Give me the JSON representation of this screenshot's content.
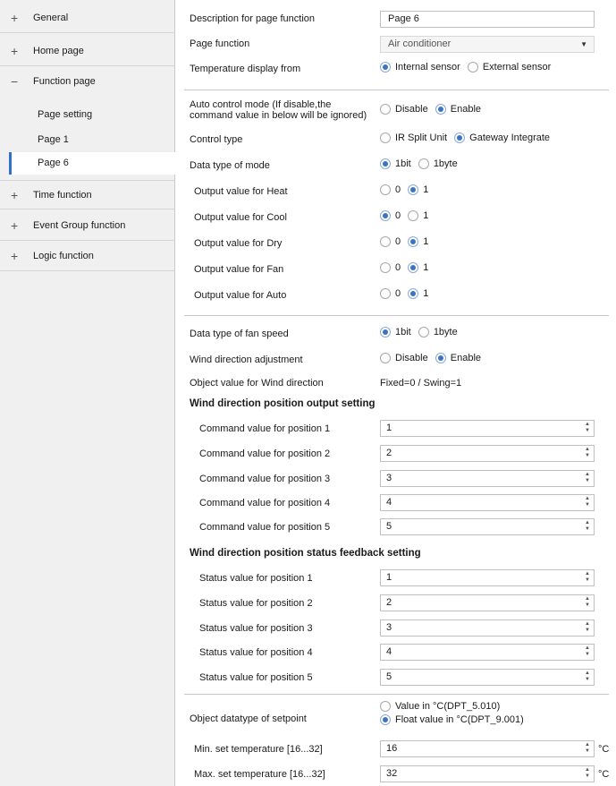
{
  "sidebar": {
    "items": [
      {
        "icon": "+",
        "label": "General"
      },
      {
        "icon": "+",
        "label": "Home page"
      },
      {
        "icon": "−",
        "label": "Function page"
      },
      {
        "icon": "+",
        "label": "Time function"
      },
      {
        "icon": "+",
        "label": "Event Group function"
      },
      {
        "icon": "+",
        "label": "Logic function"
      }
    ],
    "subitems": [
      "Page setting",
      "Page 1",
      "Page 6"
    ]
  },
  "form": {
    "description": {
      "label": "Description for page function",
      "value": "Page 6"
    },
    "page_function": {
      "label": "Page function",
      "value": "Air conditioner"
    },
    "temp_display": {
      "label": "Temperature display  from",
      "options": [
        "Internal sensor",
        "External sensor"
      ],
      "selected": 0
    },
    "auto_control": {
      "label1": "Auto control mode (If disable,the",
      "label2": "command value in below will be ignored)",
      "options": [
        "Disable",
        "Enable"
      ],
      "selected": 1
    },
    "control_type": {
      "label": "Control type",
      "options": [
        "IR Split Unit",
        "Gateway Integrate"
      ],
      "selected": 1
    },
    "data_type_mode": {
      "label": "Data type of mode",
      "options": [
        "1bit",
        "1byte"
      ],
      "selected": 0
    },
    "outputs": [
      {
        "label": "Output value for Heat",
        "options": [
          "0",
          "1"
        ],
        "selected": 1
      },
      {
        "label": "Output value for Cool",
        "options": [
          "0",
          "1"
        ],
        "selected": 0
      },
      {
        "label": "Output value for Dry",
        "options": [
          "0",
          "1"
        ],
        "selected": 1
      },
      {
        "label": "Output value for Fan",
        "options": [
          "0",
          "1"
        ],
        "selected": 1
      },
      {
        "label": "Output value for Auto",
        "options": [
          "0",
          "1"
        ],
        "selected": 1
      }
    ],
    "fan_speed_type": {
      "label": "Data type of fan speed",
      "options": [
        "1bit",
        "1byte"
      ],
      "selected": 0
    },
    "wind_adjust": {
      "label": "Wind direction adjustment",
      "options": [
        "Disable",
        "Enable"
      ],
      "selected": 1
    },
    "wind_object": {
      "label": "Object value for Wind direction",
      "value": "Fixed=0 / Swing=1"
    },
    "position_output_heading": "Wind direction position output setting",
    "position_output": [
      {
        "label": "Command value for position 1",
        "value": "1"
      },
      {
        "label": "Command value for position 2",
        "value": "2"
      },
      {
        "label": "Command value for position 3",
        "value": "3"
      },
      {
        "label": "Command value for position 4",
        "value": "4"
      },
      {
        "label": "Command value for position 5",
        "value": "5"
      }
    ],
    "position_status_heading": "Wind direction position status feedback setting",
    "position_status": [
      {
        "label": "Status value for position 1",
        "value": "1"
      },
      {
        "label": "Status value for position 2",
        "value": "2"
      },
      {
        "label": "Status value for position 3",
        "value": "3"
      },
      {
        "label": "Status value for position 4",
        "value": "4"
      },
      {
        "label": "Status value for position 5",
        "value": "5"
      }
    ],
    "setpoint_type": {
      "label": "Object datatype of setpoint",
      "options": [
        "Value in °C(DPT_5.010)",
        "Float value in °C(DPT_9.001)"
      ],
      "selected": 1
    },
    "min_temp": {
      "label": "Min. set temperature [16...32]",
      "value": "16",
      "unit": "°C"
    },
    "max_temp": {
      "label": "Max. set temperature [16...32]",
      "value": "32",
      "unit": "°C"
    }
  },
  "colors": {
    "accent": "#3b74c6",
    "sidebar_bg": "#f0f0f0",
    "selection_bar": "#2f6fd0"
  }
}
